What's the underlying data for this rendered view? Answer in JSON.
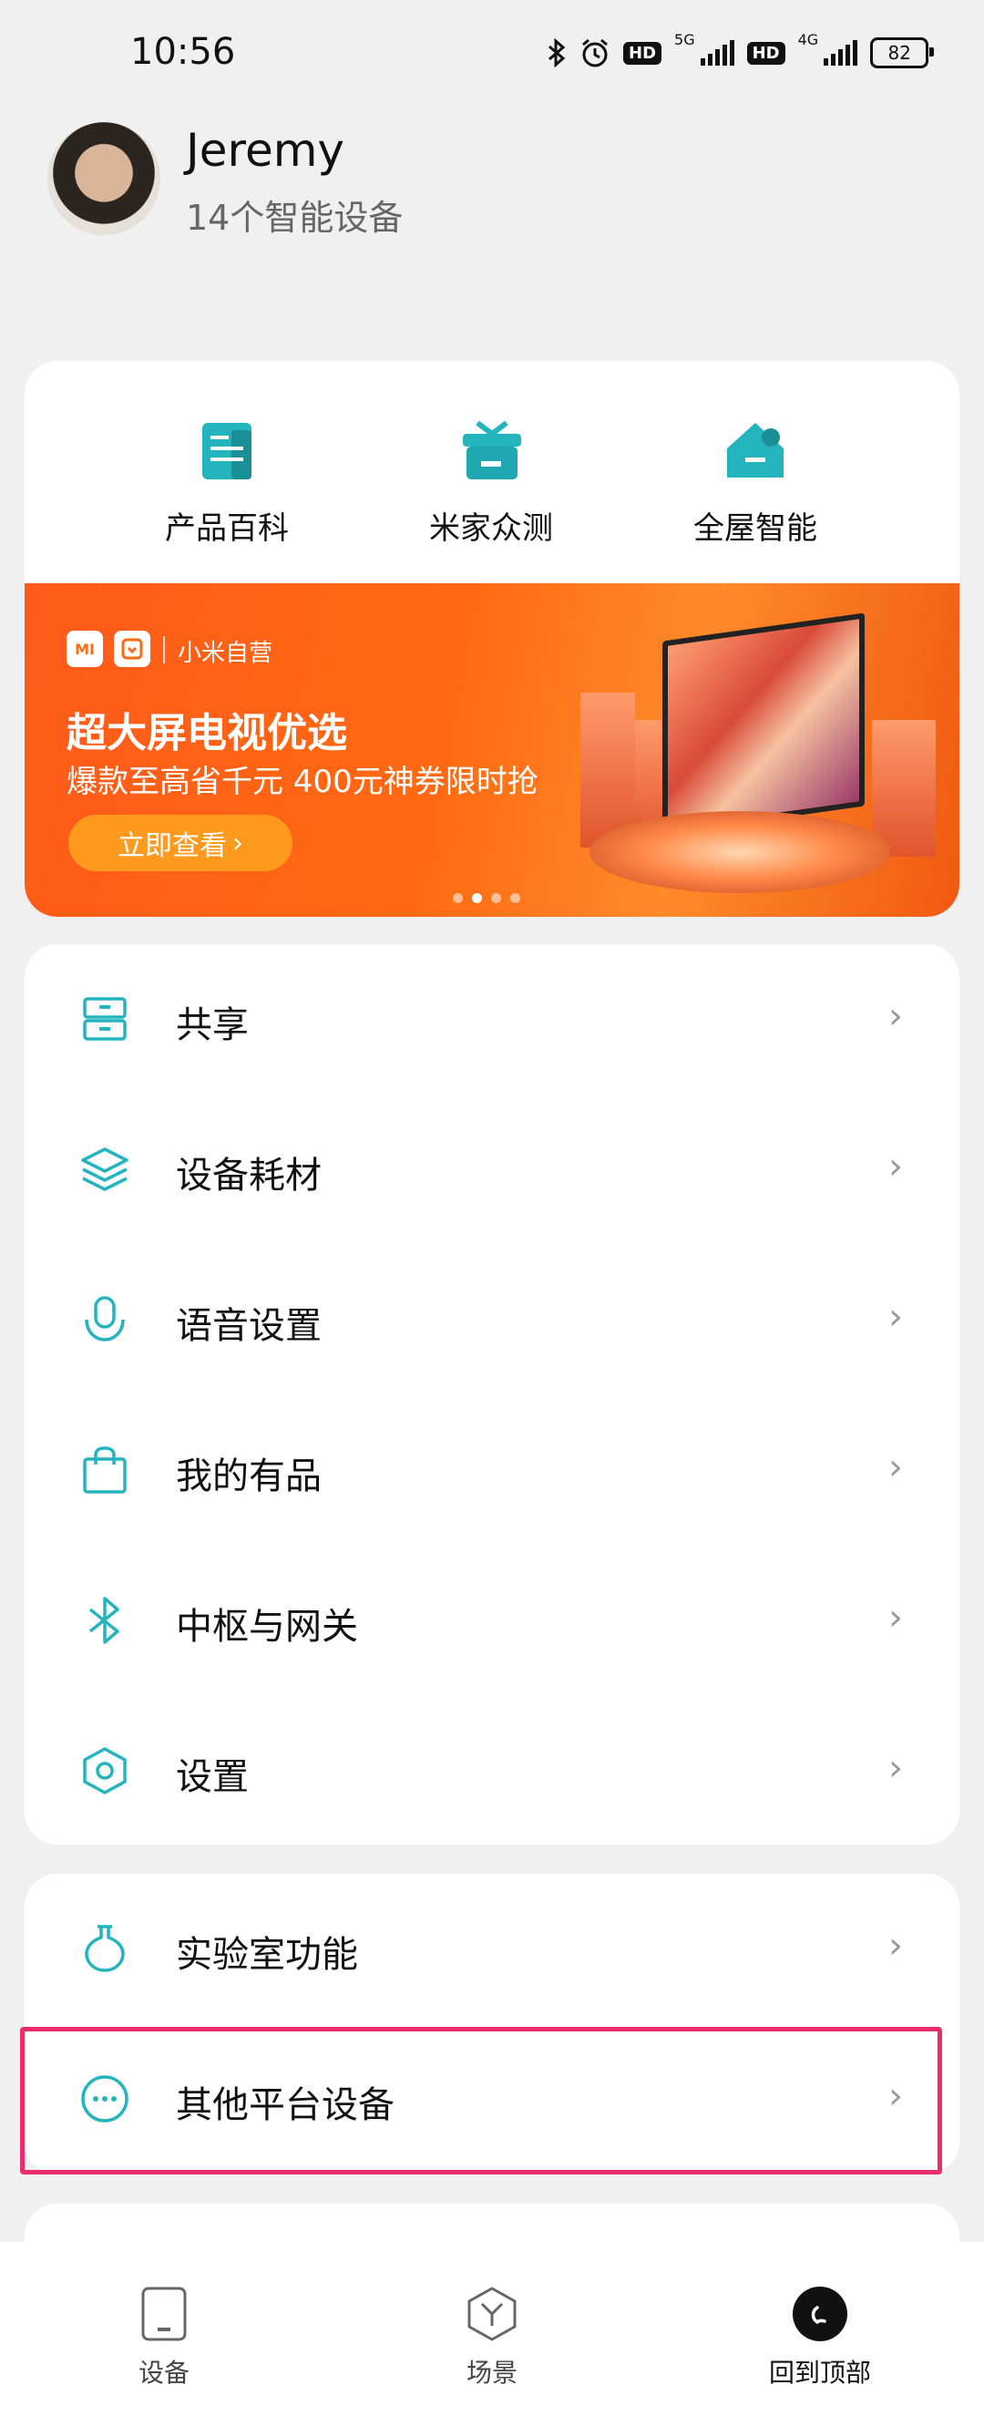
{
  "status_bar": {
    "time": "10:56",
    "hd1": "HD",
    "net1": "5G",
    "hd2": "HD",
    "net2": "4G",
    "battery": "82"
  },
  "profile": {
    "name": "Jeremy",
    "device_count": "14个智能设备"
  },
  "quick_actions": [
    {
      "label": "产品百科",
      "icon": "document-icon"
    },
    {
      "label": "米家众测",
      "icon": "gift-icon"
    },
    {
      "label": "全屋智能",
      "icon": "smart-home-icon"
    }
  ],
  "banner": {
    "brand": "小米自营",
    "title": "超大屏电视优选",
    "subtitle": "爆款至高省千元 400元神券限时抢",
    "button": "立即查看",
    "logo_mi": "MI",
    "page_count": 4,
    "active_page": 2
  },
  "menu_group1": [
    {
      "label": "共享",
      "icon": "share-icon"
    },
    {
      "label": "设备耗材",
      "icon": "layers-icon"
    },
    {
      "label": "语音设置",
      "icon": "microphone-icon"
    },
    {
      "label": "我的有品",
      "icon": "shopping-bag-icon"
    },
    {
      "label": "中枢与网关",
      "icon": "bluetooth-icon"
    },
    {
      "label": "设置",
      "icon": "hexagon-gear-icon"
    }
  ],
  "menu_group2": [
    {
      "label": "实验室功能",
      "icon": "flask-icon"
    },
    {
      "label": "其他平台设备",
      "icon": "more-dots-icon"
    }
  ],
  "bottom_nav": [
    {
      "label": "设备",
      "icon": "device-icon"
    },
    {
      "label": "场景",
      "icon": "scene-cube-icon"
    },
    {
      "label": "回到顶部",
      "icon": "back-to-top-icon"
    }
  ],
  "colors": {
    "accent": "#24b4bd",
    "banner_orange": "#ff6a12",
    "highlight": "#ec2d6b"
  }
}
